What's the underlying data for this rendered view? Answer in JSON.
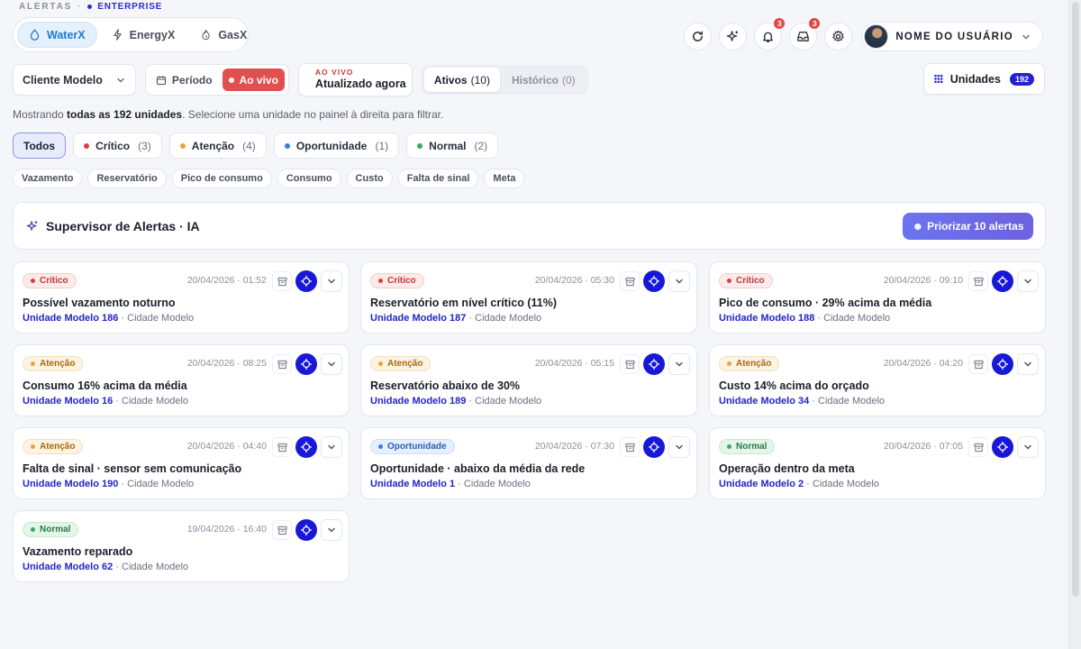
{
  "breadcrumb": {
    "section": "ALERTAS",
    "plan": "ENTERPRISE"
  },
  "products": [
    {
      "label": "WaterX",
      "icon": "droplet-icon",
      "active": true
    },
    {
      "label": "EnergyX",
      "icon": "bolt-icon",
      "active": false
    },
    {
      "label": "GasX",
      "icon": "flame-icon",
      "active": false
    }
  ],
  "header": {
    "notifications_count": "3",
    "inbox_count": "3",
    "user_name": "NOME DO USUÁRIO"
  },
  "toolbar": {
    "client_select": "Cliente Modelo",
    "period_label": "Período",
    "live_toggle_label": "Ao vivo",
    "live_status_label": "AO VIVO",
    "live_status_value": "Atualizado agora",
    "tabs": [
      {
        "label": "Ativos",
        "count": "(10)",
        "active": true
      },
      {
        "label": "Histórico",
        "count": "(0)",
        "active": false
      }
    ],
    "units_label": "Unidades",
    "units_count": "192"
  },
  "summary": {
    "prefix": "Mostrando ",
    "bold": "todas as 192 unidades",
    "suffix": ". Selecione uma unidade no painel à direita para filtrar."
  },
  "severity_filters": [
    {
      "label": "Todos",
      "count": "",
      "color": "",
      "active": true
    },
    {
      "label": "Crítico",
      "count": "(3)",
      "color": "#d84040",
      "active": false
    },
    {
      "label": "Atenção",
      "count": "(4)",
      "color": "#e8a43a",
      "active": false
    },
    {
      "label": "Oportunidade",
      "count": "(1)",
      "color": "#3a7be0",
      "active": false
    },
    {
      "label": "Normal",
      "count": "(2)",
      "color": "#3aa862",
      "active": false
    }
  ],
  "type_filters": [
    "Vazamento",
    "Reservatório",
    "Pico de consumo",
    "Consumo",
    "Custo",
    "Falta de sinal",
    "Meta"
  ],
  "supervisor": {
    "title": "Supervisor de Alertas · IA",
    "button_label": "Priorizar 10 alertas"
  },
  "alerts": [
    {
      "severity": "Crítico",
      "kind": "critico",
      "timestamp": "20/04/2026 · 01:52",
      "title": "Possível vazamento noturno",
      "unit": "Unidade Modelo 186",
      "city": " · Cidade Modelo"
    },
    {
      "severity": "Crítico",
      "kind": "critico",
      "timestamp": "20/04/2026 · 05:30",
      "title": "Reservatório em nível crítico (11%)",
      "unit": "Unidade Modelo 187",
      "city": " · Cidade Modelo"
    },
    {
      "severity": "Crítico",
      "kind": "critico",
      "timestamp": "20/04/2026 · 09:10",
      "title": "Pico de consumo · 29% acima da média",
      "unit": "Unidade Modelo 188",
      "city": " · Cidade Modelo"
    },
    {
      "severity": "Atenção",
      "kind": "atencao",
      "timestamp": "20/04/2026 · 08:25",
      "title": "Consumo 16% acima da média",
      "unit": "Unidade Modelo 16",
      "city": " · Cidade Modelo"
    },
    {
      "severity": "Atenção",
      "kind": "atencao",
      "timestamp": "20/04/2026 · 05:15",
      "title": "Reservatório abaixo de 30%",
      "unit": "Unidade Modelo 189",
      "city": " · Cidade Modelo"
    },
    {
      "severity": "Atenção",
      "kind": "atencao",
      "timestamp": "20/04/2026 · 04:20",
      "title": "Custo 14% acima do orçado",
      "unit": "Unidade Modelo 34",
      "city": " · Cidade Modelo"
    },
    {
      "severity": "Atenção",
      "kind": "atencao",
      "timestamp": "20/04/2026 · 04:40",
      "title": "Falta de sinal · sensor sem comunicação",
      "unit": "Unidade Modelo 190",
      "city": " · Cidade Modelo"
    },
    {
      "severity": "Oportunidade",
      "kind": "oportunidade",
      "timestamp": "20/04/2026 · 07:30",
      "title": "Oportunidade · abaixo da média da rede",
      "unit": "Unidade Modelo 1",
      "city": " · Cidade Modelo"
    },
    {
      "severity": "Normal",
      "kind": "normal",
      "timestamp": "20/04/2026 · 07:05",
      "title": "Operação dentro da meta",
      "unit": "Unidade Modelo 2",
      "city": " · Cidade Modelo"
    },
    {
      "severity": "Normal",
      "kind": "normal",
      "timestamp": "19/04/2026 · 16:40",
      "title": "Vazamento reparado",
      "unit": "Unidade Modelo 62",
      "city": " · Cidade Modelo"
    }
  ]
}
